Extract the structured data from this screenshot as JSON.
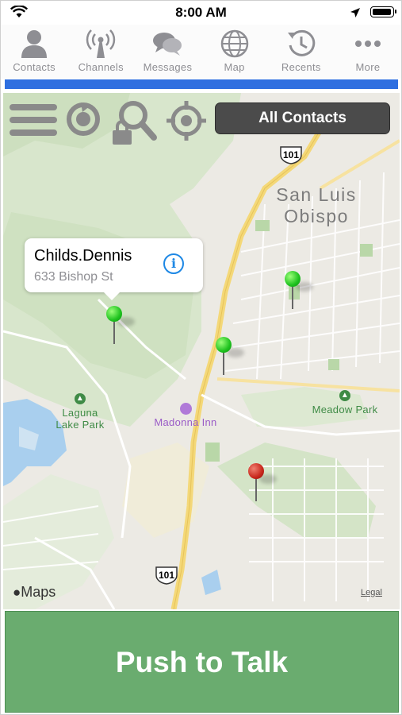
{
  "status_bar": {
    "time": "8:00 AM"
  },
  "tabs": [
    {
      "label": "Contacts",
      "icon": "person-icon"
    },
    {
      "label": "Channels",
      "icon": "antenna-icon"
    },
    {
      "label": "Messages",
      "icon": "chat-bubbles-icon"
    },
    {
      "label": "Map",
      "icon": "globe-icon"
    },
    {
      "label": "Recents",
      "icon": "clock-history-icon"
    },
    {
      "label": "More",
      "icon": "ellipsis-icon"
    }
  ],
  "map": {
    "filter_button": "All Contacts",
    "callout": {
      "name": "Childs.Dennis",
      "address": "633 Bishop St"
    },
    "labels": {
      "city_line1": "San Luis",
      "city_line2": "Obispo",
      "park1_line1": "Laguna",
      "park1_line2": "Lake Park",
      "park2": "Meadow Park",
      "poi": "Madonna Inn",
      "highway_top": "101",
      "highway_bottom": "101"
    },
    "attribution": "Maps",
    "legal": "Legal",
    "pins": [
      {
        "color": "green"
      },
      {
        "color": "green"
      },
      {
        "color": "green"
      },
      {
        "color": "red"
      }
    ]
  },
  "push_to_talk": "Push to Talk",
  "colors": {
    "accent_strip": "#2f6fe0",
    "ptt_green": "#6aac6f",
    "pin_green": "#1ec21e",
    "pin_red": "#c8271c"
  }
}
